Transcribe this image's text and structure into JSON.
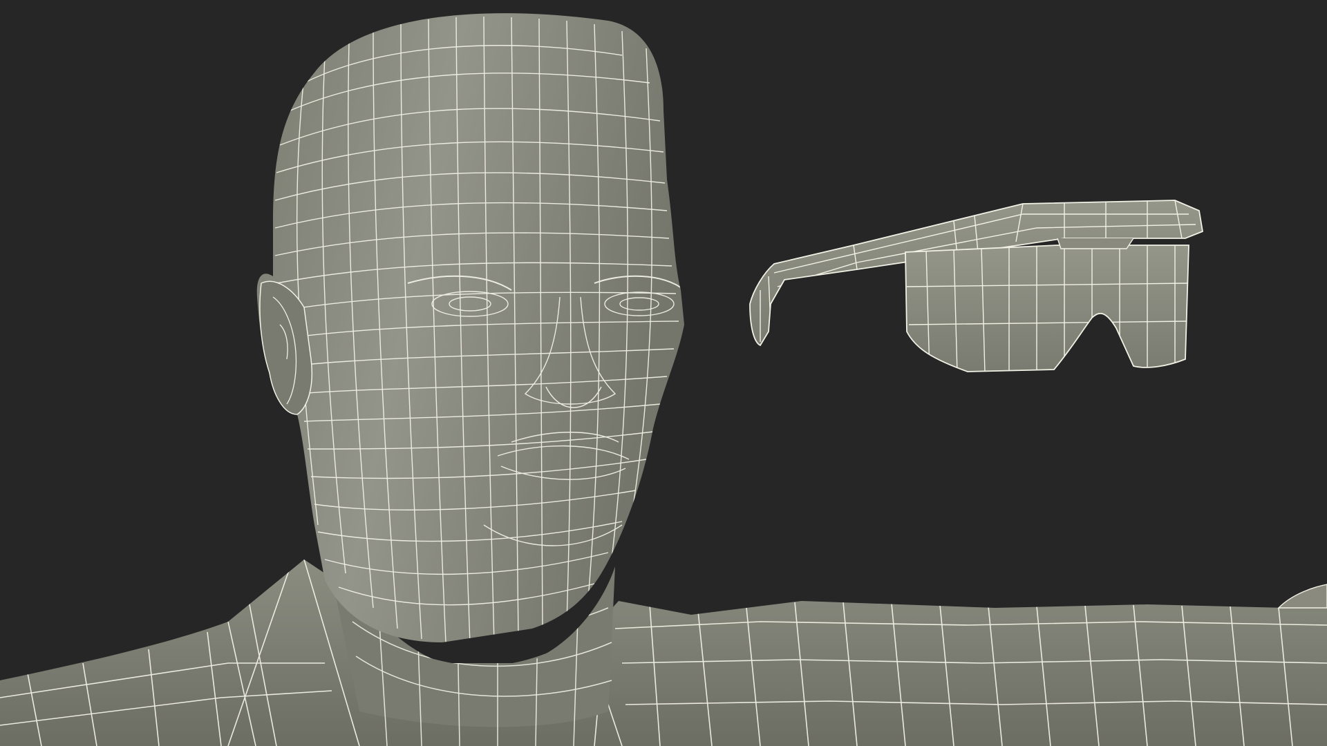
{
  "scene": {
    "background_color": "#262626",
    "surface_color": "#8a8b7e",
    "surface_shadow_color": "#6f7066",
    "surface_highlight_color": "#a3a496",
    "wire_color": "#f2f1e6",
    "objects": [
      "head-mesh",
      "torso-mesh",
      "arm-mesh",
      "glasses-mesh"
    ]
  }
}
